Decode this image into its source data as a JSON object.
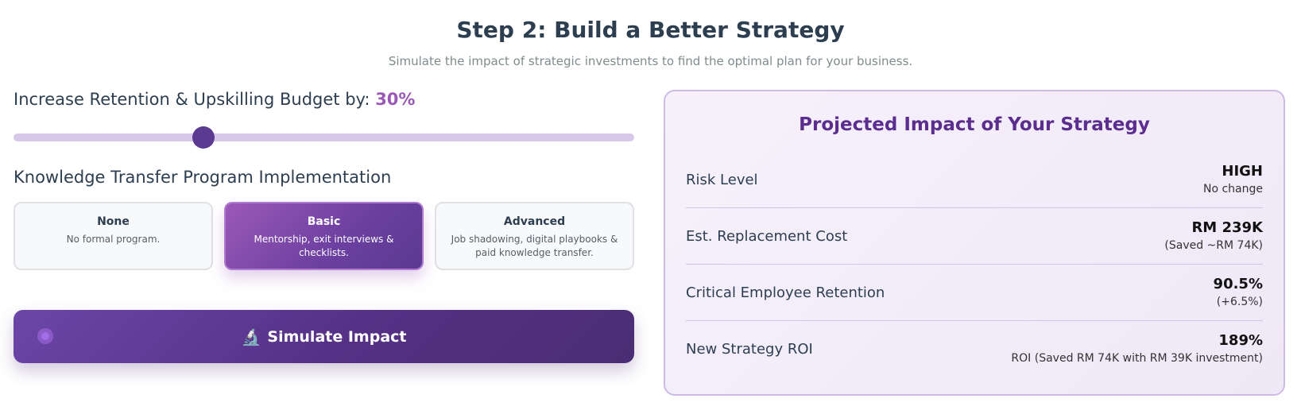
{
  "header": {
    "title": "Step 2: Build a Better Strategy",
    "subtitle": "Simulate the impact of strategic investments to find the optimal plan for your business."
  },
  "budget": {
    "label": "Increase Retention & Upskilling Budget by:",
    "value_label": "30%",
    "slider_value": 30,
    "slider_fraction": 0.3
  },
  "ktp": {
    "title": "Knowledge Transfer Program Implementation",
    "options": [
      {
        "title": "None",
        "desc": "No formal program.",
        "selected": false
      },
      {
        "title": "Basic",
        "desc": "Mentorship, exit interviews & checklists.",
        "selected": true
      },
      {
        "title": "Advanced",
        "desc": "Job shadowing, digital playbooks & paid knowledge transfer.",
        "selected": false
      }
    ]
  },
  "simulate": {
    "label": "Simulate Impact",
    "icon": "microscope-icon",
    "icon_glyph": "🔬"
  },
  "panel": {
    "title": "Projected Impact of Your Strategy",
    "metrics": [
      {
        "label": "Risk Level",
        "value": "HIGH",
        "note": "No change"
      },
      {
        "label": "Est. Replacement Cost",
        "value": "RM 239K",
        "note": "(Saved ~RM 74K)"
      },
      {
        "label": "Critical Employee Retention",
        "value": "90.5%",
        "note": "(+6.5%)"
      },
      {
        "label": "New Strategy ROI",
        "value": "189%",
        "note": "ROI (Saved RM 74K with RM 39K investment)"
      }
    ]
  },
  "colors": {
    "accent": "#9b59b6",
    "primary_dark": "#5b3a91",
    "panel_title": "#5b2d8e",
    "text": "#2c3e50"
  }
}
